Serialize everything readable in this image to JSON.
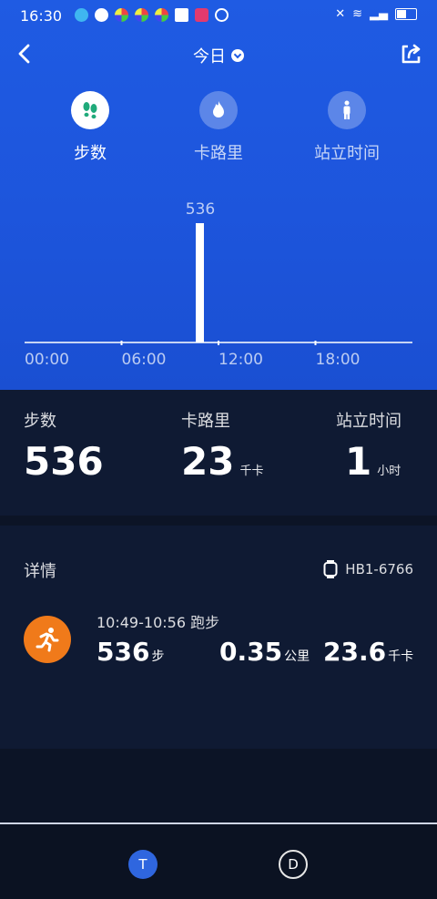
{
  "status": {
    "time": "16:30"
  },
  "header": {
    "title": "今日"
  },
  "tabs": [
    {
      "label": "步数",
      "icon": "footprints-icon",
      "active": true
    },
    {
      "label": "卡路里",
      "icon": "flame-icon",
      "active": false
    },
    {
      "label": "站立时间",
      "icon": "standing-person-icon",
      "active": false
    }
  ],
  "chart_data": {
    "type": "bar",
    "x_ticks": [
      "00:00",
      "06:00",
      "12:00",
      "18:00"
    ],
    "bars": [
      {
        "time": "10:49",
        "value": 536,
        "label": "536"
      }
    ]
  },
  "summary": {
    "steps": {
      "label": "步数",
      "value": "536",
      "unit": ""
    },
    "calories": {
      "label": "卡路里",
      "value": "23",
      "unit": "千卡"
    },
    "standing": {
      "label": "站立时间",
      "value": "1",
      "unit": "小时"
    }
  },
  "detail": {
    "title": "详情",
    "device": "HB1-6766",
    "activity": {
      "time": "10:49-10:56 跑步",
      "steps": "536",
      "steps_unit": "步",
      "distance": "0.35",
      "distance_unit": "公里",
      "calories": "23.6",
      "calories_unit": "千卡"
    }
  },
  "bottom_nav": {
    "t_label": "T",
    "d_label": "D"
  }
}
